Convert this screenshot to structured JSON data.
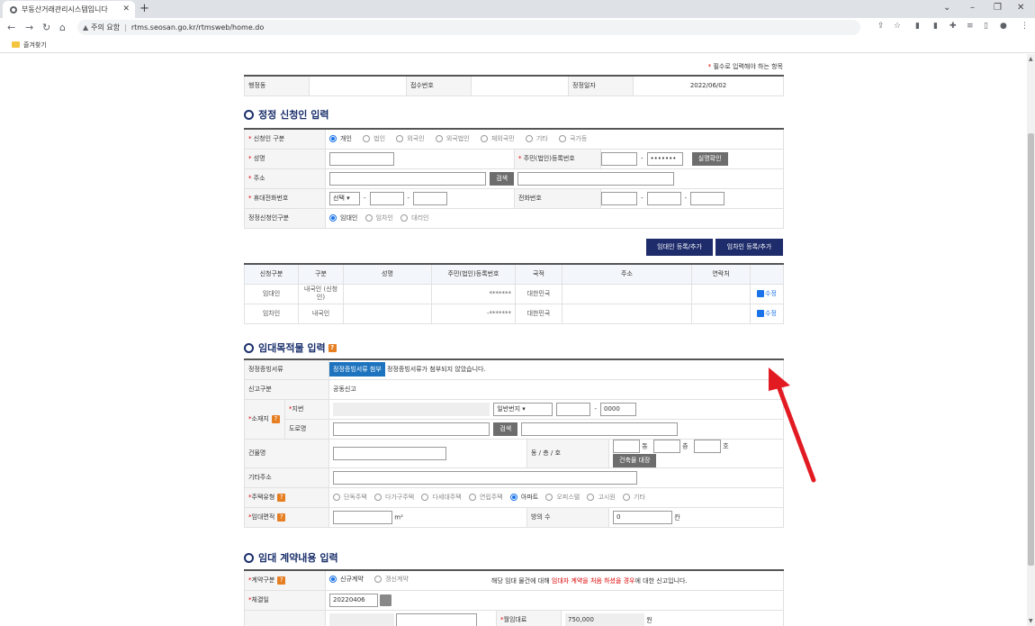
{
  "browser": {
    "tab_title": "부동산거래관리시스템입니다",
    "warning": "주의 요함",
    "url": "rtms.seosan.go.kr/rtmsweb/home.do",
    "bookmark": "즐겨찾기"
  },
  "note": {
    "text": "필수로 입력해야 하는 항목"
  },
  "top": {
    "l1": "행정동",
    "l2": "접수번호",
    "l3": "정정일자",
    "date": "2022/06/02"
  },
  "applicant": {
    "title": "정정 신청인 입력",
    "type_label": "신청인 구분",
    "type_options": [
      "개인",
      "법인",
      "외국인",
      "외국법인",
      "재외국민",
      "기타",
      "국가등"
    ],
    "name_label": "성명",
    "id_label": "주민(법인)등록번호",
    "id_masked": "•••••••",
    "confirm_btn": "실명확인",
    "addr_label": "주소",
    "search_btn": "검색",
    "mobile_label": "휴대전화번호",
    "mobile_select": "선택",
    "phone_label": "전화번호",
    "req_type_label": "정정신청인구분",
    "req_type_options": [
      "임대인",
      "임차인",
      "대리인"
    ],
    "btn_lessor": "임대인 등록/추가",
    "btn_lessee": "임차인 등록/추가"
  },
  "list": {
    "headers": [
      "신청구분",
      "구분",
      "성명",
      "주민(법인)등록번호",
      "국적",
      "주소",
      "연락처",
      ""
    ],
    "rows": [
      {
        "c1": "임대인",
        "c2": "내국인 (신청인)",
        "c4": "*******",
        "c5": "대한민국",
        "edit": "수정"
      },
      {
        "c1": "임차인",
        "c2": "내국인",
        "c4": "-*******",
        "c5": "대한민국",
        "edit": "수정"
      }
    ]
  },
  "target": {
    "title": "임대목적물 입력",
    "doc_label": "정정증빙서류",
    "doc_btn": "정정증빙서류 첨부",
    "doc_msg": "정정증빙서류가 첨부되지 않았습니다.",
    "report_label": "신고구분",
    "report_value": "공동신고",
    "loc_label": "소재지",
    "jibun_label": "지번",
    "jibun_select": "일반번지",
    "jibun_sub": "0000",
    "road_label": "도로명",
    "search_btn": "검색",
    "bldg_label": "건물명",
    "dong_label": "동 / 층 / 호",
    "dong": "동",
    "floor": "층",
    "ho": "호",
    "ledger_btn": "건축물 대장",
    "etc_label": "기타주소",
    "house_label": "주택유형",
    "house_options": [
      "단독주택",
      "다가구주택",
      "다세대주택",
      "연립주택",
      "아파트",
      "오피스텔",
      "고시원",
      "기타"
    ],
    "area_label": "임대면적",
    "area_unit": "m²",
    "rooms_label": "방의 수",
    "rooms_value": "0",
    "rooms_unit": "칸"
  },
  "contract": {
    "title": "임대 계약내용 입력",
    "type_label": "계약구분",
    "type_options": [
      "신규계약",
      "갱신계약"
    ],
    "note_pre": "해당 임대 물건에 대해 ",
    "note_red": "임대자 계약을 처음 하셨을 경우",
    "note_post": "에 대한 신고입니다.",
    "date_label": "체결일",
    "date_value": "20220406",
    "rent_label": "월임대료",
    "rent_value": "750,000",
    "rent_unit": "원"
  }
}
